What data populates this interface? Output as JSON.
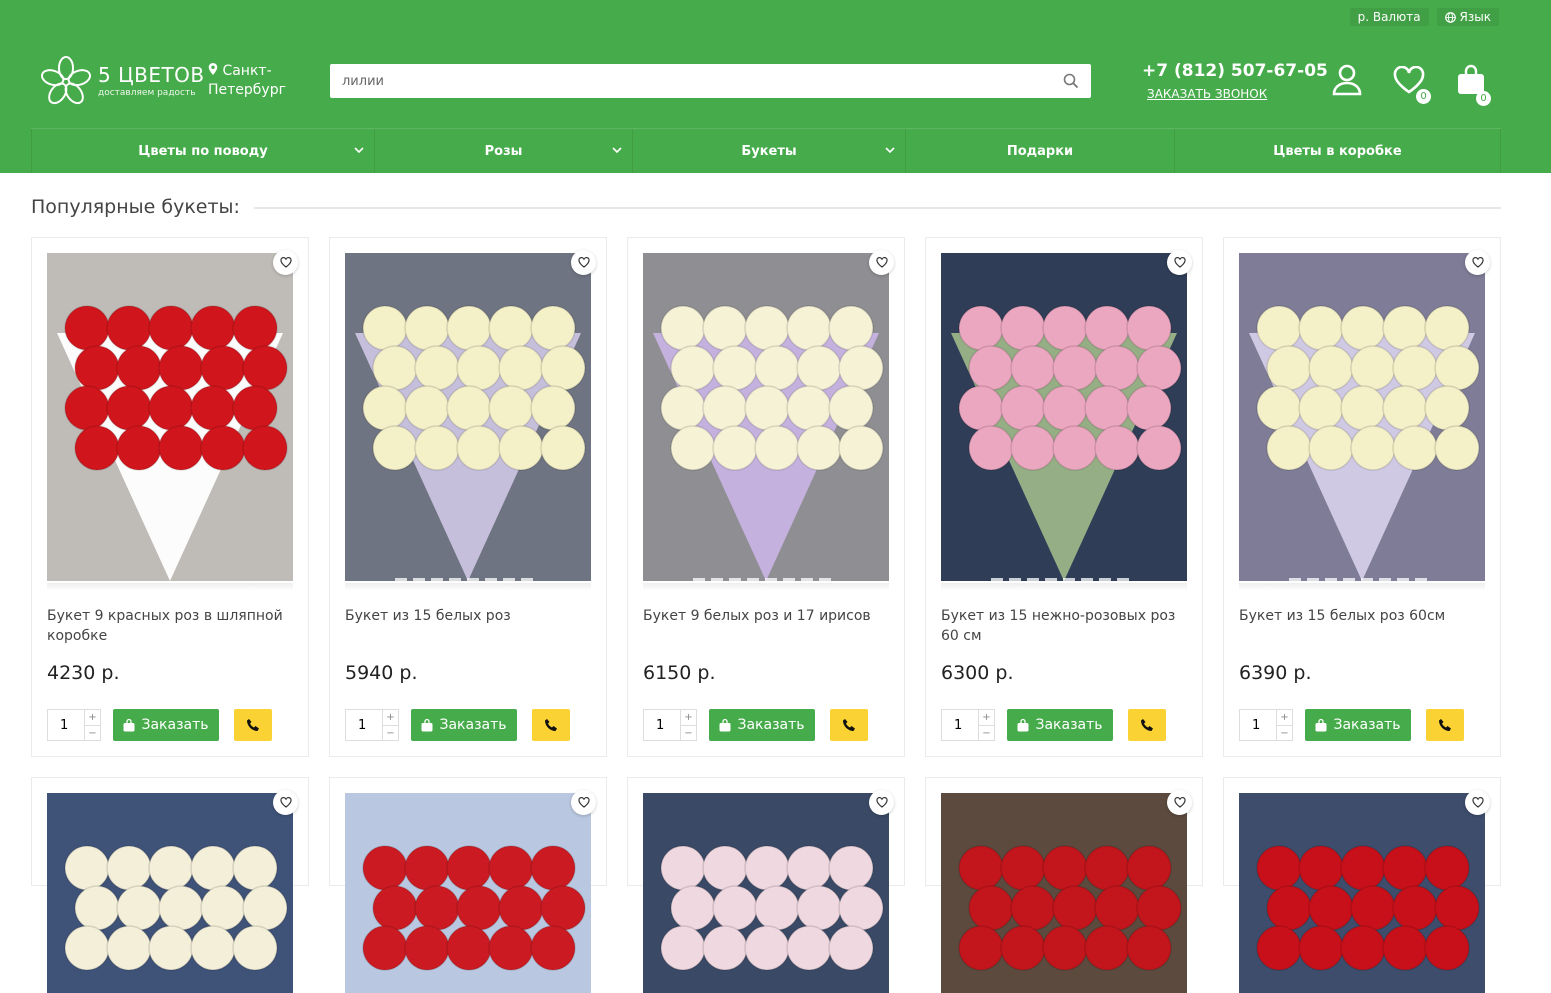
{
  "topbar": {
    "currency": "р.  Валюта",
    "language": "Язык"
  },
  "logo": {
    "name": "5 ЦВЕТОВ",
    "tagline": "доставляем радость"
  },
  "city": "Санкт-Петербург",
  "search": {
    "value": "лилии"
  },
  "contact": {
    "phone": "+7 (812) 507-67-05",
    "callback": "ЗАКАЗАТЬ ЗВОНОК"
  },
  "header_icons": {
    "wishlist_count": "0",
    "cart_count": "0"
  },
  "nav": [
    {
      "label": "Цветы по поводу",
      "dropdown": true
    },
    {
      "label": "Розы",
      "dropdown": true
    },
    {
      "label": "Букеты",
      "dropdown": true
    },
    {
      "label": "Подарки",
      "dropdown": false
    },
    {
      "label": "Цветы в коробке",
      "dropdown": false
    }
  ],
  "section_title": "Популярные букеты:",
  "order_label": "Заказать",
  "products": [
    {
      "name": "Букет 9 красных роз в шляпной коробке",
      "price": "4230 р.",
      "qty": "1",
      "bg": "#bfbcb8",
      "flower": "#d1151c",
      "wrap": "#ffffff"
    },
    {
      "name": "Букет из 15 белых роз",
      "price": "5940 р.",
      "qty": "1",
      "bg": "#6f7482",
      "flower": "#f4f0c8",
      "wrap": "#c9c3e0"
    },
    {
      "name": "Букет 9 белых роз и 17 ирисов",
      "price": "6150 р.",
      "qty": "1",
      "bg": "#8f8e92",
      "flower": "#f5f2d6",
      "wrap": "#c7b3e3"
    },
    {
      "name": "Букет из 15 нежно-розовых роз 60 см",
      "price": "6300 р.",
      "qty": "1",
      "bg": "#2f3d57",
      "flower": "#eca7c0",
      "wrap": "#9cb488"
    },
    {
      "name": "Букет из 15 белых роз 60см",
      "price": "6390 р.",
      "qty": "1",
      "bg": "#7e7c96",
      "flower": "#f4f0c8",
      "wrap": "#d5cde8"
    }
  ],
  "products_row2": [
    {
      "bg": "#3f5278",
      "flower": "#f3efd8"
    },
    {
      "bg": "#b9c8e0",
      "flower": "#cc1a22"
    },
    {
      "bg": "#3a4a66",
      "flower": "#f0d8e0"
    },
    {
      "bg": "#5c4a3e",
      "flower": "#c3151c"
    },
    {
      "bg": "#3e4d6c",
      "flower": "#c8101a"
    }
  ],
  "colors": {
    "brand_green": "#46ab4a",
    "call_yellow": "#fbd233"
  }
}
